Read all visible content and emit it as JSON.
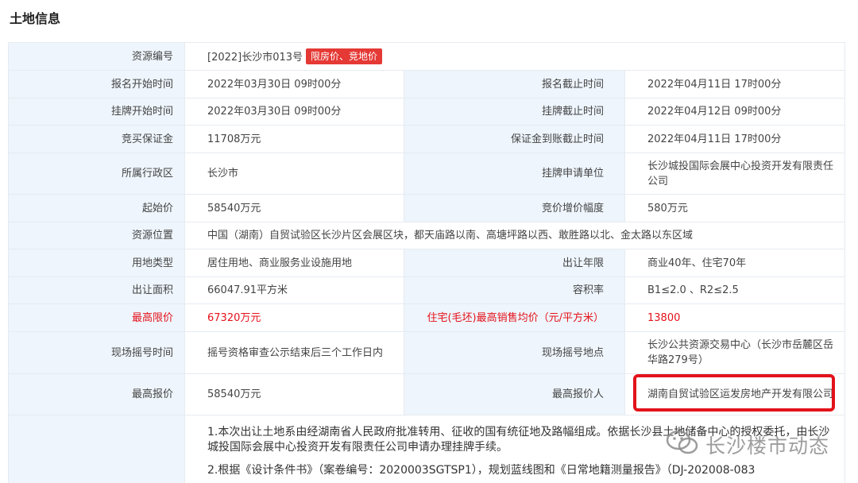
{
  "title": "土地信息",
  "rows": {
    "r1": {
      "l": "资源编号",
      "v": "[2022]长沙市013号",
      "tag": "限房价、竞地价"
    },
    "r2": {
      "l": "报名开始时间",
      "v": "2022年03月30日 09时00分",
      "l2": "报名截止时间",
      "v2": "2022年04月11日 17时00分"
    },
    "r3": {
      "l": "挂牌开始时间",
      "v": "2022年03月30日 09时00分",
      "l2": "挂牌截止时间",
      "v2": "2022年04月12日 09时00分"
    },
    "r4": {
      "l": "竞买保证金",
      "v": "11708万元",
      "l2": "保证金到账截止时间",
      "v2": "2022年04月11日 17时00分"
    },
    "r5": {
      "l": "所属行政区",
      "v": "长沙市",
      "l2": "挂牌申请单位",
      "v2": "长沙城投国际会展中心投资开发有限责任公司"
    },
    "r6": {
      "l": "起始价",
      "v": "58540万元",
      "l2": "竞价增价幅度",
      "v2": "580万元"
    },
    "r7": {
      "l": "资源位置",
      "v": "中国（湖南）自贸试验区长沙片区会展区块，都天庙路以南、高塘坪路以西、敢胜路以北、金太路以东区域"
    },
    "r8": {
      "l": "用地类型",
      "v": "居住用地、商业服务业设施用地",
      "l2": "出让年限",
      "v2": "商业40年、住宅70年"
    },
    "r9": {
      "l": "出让面积",
      "v": "66047.91平方米",
      "l2": "容积率",
      "v2": "B1≤2.0 、R2≤2.5"
    },
    "r10": {
      "l": "最高限价",
      "v": "67320万元",
      "l2": "住宅(毛坯)最高销售均价（元/平方米）",
      "v2": "13800"
    },
    "r11": {
      "l": "现场摇号时间",
      "v": "摇号资格审查公示结束后三个工作日内",
      "l2": "现场摇号地点",
      "v2": "长沙公共资源交易中心（长沙市岳麓区岳华路279号）"
    },
    "r12": {
      "l": "最高报价",
      "v": "58540万元",
      "l2": "最高报价人",
      "v2": "湖南自贸试验区运发房地产开发有限公司"
    }
  },
  "notes": {
    "n1": "1.本次出让土地系由经湖南省人民政府批准转用、征收的国有统征地及路幅组成。依据长沙县土地储备中心的授权委托，由长沙城投国际会展中心投资开发有限责任公司申请办理挂牌手续。",
    "n2": "2.根据《设计条件书》（案卷编号：2020003SGTSP1），规划蓝线图和《日常地籍测量报告》（DJ-202008-083"
  },
  "watermark": {
    "text": "长沙楼市动态",
    "icon": "wechat-icon"
  },
  "colors": {
    "label_bg": "#eef5fc",
    "highlight": "#e5111a",
    "tag_bg": "#e53935"
  }
}
